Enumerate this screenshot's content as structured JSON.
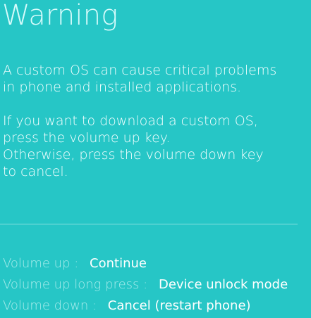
{
  "title": "Warning",
  "message": {
    "paragraph_1": [
      "A custom OS can cause critical problems",
      "in phone and installed applications."
    ],
    "paragraph_2": [
      "If you want to download a custom OS,",
      "press the volume up key.",
      "Otherwise, press the volume down key",
      "to cancel."
    ]
  },
  "keys": [
    {
      "name": "Volume up :",
      "action": "Continue"
    },
    {
      "name": "Volume up long press :",
      "action": "Device unlock mode"
    },
    {
      "name": "Volume down :",
      "action": "Cancel (restart phone)"
    }
  ],
  "colors": {
    "background": "#26c6c6",
    "title": "#d6fbfb",
    "text": "#ffffff",
    "key_label": "#a8ecec"
  }
}
